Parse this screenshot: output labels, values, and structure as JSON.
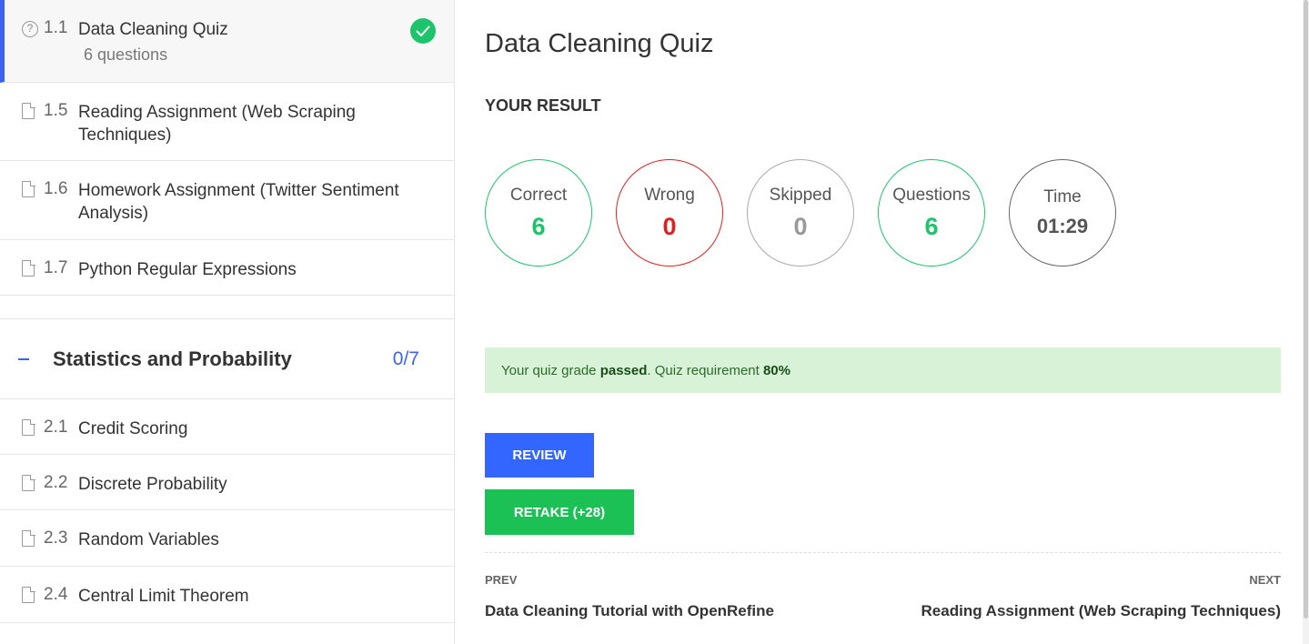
{
  "sidebar": {
    "active_item": {
      "num": "1.1",
      "title": "Data Cleaning Quiz",
      "sub": "6 questions"
    },
    "lessons_top": [
      {
        "num": "1.5",
        "title": "Reading Assignment (Web Scraping Techniques)"
      },
      {
        "num": "1.6",
        "title": "Homework Assignment (Twitter Sentiment Analysis)"
      },
      {
        "num": "1.7",
        "title": "Python Regular Expressions"
      }
    ],
    "section": {
      "title": "Statistics and Probability",
      "count": "0/7"
    },
    "lessons_bottom": [
      {
        "num": "2.1",
        "title": "Credit Scoring"
      },
      {
        "num": "2.2",
        "title": "Discrete Probability"
      },
      {
        "num": "2.3",
        "title": "Random Variables"
      },
      {
        "num": "2.4",
        "title": "Central Limit Theorem"
      }
    ]
  },
  "main": {
    "title": "Data Cleaning Quiz",
    "result_label": "YOUR RESULT",
    "stats": [
      {
        "label": "Correct",
        "value": "6"
      },
      {
        "label": "Wrong",
        "value": "0"
      },
      {
        "label": "Skipped",
        "value": "0"
      },
      {
        "label": "Questions",
        "value": "6"
      },
      {
        "label": "Time",
        "value": "01:29"
      }
    ],
    "grade": {
      "prefix": "Your quiz grade ",
      "status": "passed",
      "middle": ". Quiz requirement ",
      "requirement": "80%"
    },
    "review_label": "REVIEW",
    "retake_label": "RETAKE (+28)",
    "nav": {
      "prev_label": "PREV",
      "prev_title": "Data Cleaning Tutorial with OpenRefine",
      "next_label": "NEXT",
      "next_title": "Reading Assignment (Web Scraping Techniques)"
    }
  },
  "colors": {
    "accent": "#3366ff",
    "success": "#1cc56b",
    "danger": "#e02020",
    "grade_bg": "#d8f2d8"
  }
}
